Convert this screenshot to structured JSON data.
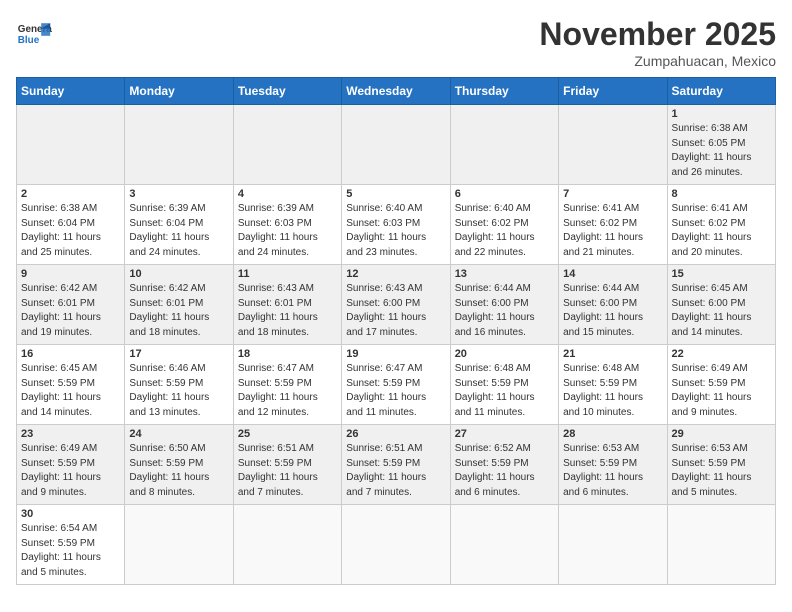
{
  "header": {
    "logo_general": "General",
    "logo_blue": "Blue",
    "month": "November 2025",
    "location": "Zumpahuacan, Mexico"
  },
  "weekdays": [
    "Sunday",
    "Monday",
    "Tuesday",
    "Wednesday",
    "Thursday",
    "Friday",
    "Saturday"
  ],
  "weeks": [
    [
      {
        "day": "",
        "info": ""
      },
      {
        "day": "",
        "info": ""
      },
      {
        "day": "",
        "info": ""
      },
      {
        "day": "",
        "info": ""
      },
      {
        "day": "",
        "info": ""
      },
      {
        "day": "",
        "info": ""
      },
      {
        "day": "1",
        "info": "Sunrise: 6:38 AM\nSunset: 6:05 PM\nDaylight: 11 hours\nand 26 minutes."
      }
    ],
    [
      {
        "day": "2",
        "info": "Sunrise: 6:38 AM\nSunset: 6:04 PM\nDaylight: 11 hours\nand 25 minutes."
      },
      {
        "day": "3",
        "info": "Sunrise: 6:39 AM\nSunset: 6:04 PM\nDaylight: 11 hours\nand 24 minutes."
      },
      {
        "day": "4",
        "info": "Sunrise: 6:39 AM\nSunset: 6:03 PM\nDaylight: 11 hours\nand 24 minutes."
      },
      {
        "day": "5",
        "info": "Sunrise: 6:40 AM\nSunset: 6:03 PM\nDaylight: 11 hours\nand 23 minutes."
      },
      {
        "day": "6",
        "info": "Sunrise: 6:40 AM\nSunset: 6:02 PM\nDaylight: 11 hours\nand 22 minutes."
      },
      {
        "day": "7",
        "info": "Sunrise: 6:41 AM\nSunset: 6:02 PM\nDaylight: 11 hours\nand 21 minutes."
      },
      {
        "day": "8",
        "info": "Sunrise: 6:41 AM\nSunset: 6:02 PM\nDaylight: 11 hours\nand 20 minutes."
      }
    ],
    [
      {
        "day": "9",
        "info": "Sunrise: 6:42 AM\nSunset: 6:01 PM\nDaylight: 11 hours\nand 19 minutes."
      },
      {
        "day": "10",
        "info": "Sunrise: 6:42 AM\nSunset: 6:01 PM\nDaylight: 11 hours\nand 18 minutes."
      },
      {
        "day": "11",
        "info": "Sunrise: 6:43 AM\nSunset: 6:01 PM\nDaylight: 11 hours\nand 18 minutes."
      },
      {
        "day": "12",
        "info": "Sunrise: 6:43 AM\nSunset: 6:00 PM\nDaylight: 11 hours\nand 17 minutes."
      },
      {
        "day": "13",
        "info": "Sunrise: 6:44 AM\nSunset: 6:00 PM\nDaylight: 11 hours\nand 16 minutes."
      },
      {
        "day": "14",
        "info": "Sunrise: 6:44 AM\nSunset: 6:00 PM\nDaylight: 11 hours\nand 15 minutes."
      },
      {
        "day": "15",
        "info": "Sunrise: 6:45 AM\nSunset: 6:00 PM\nDaylight: 11 hours\nand 14 minutes."
      }
    ],
    [
      {
        "day": "16",
        "info": "Sunrise: 6:45 AM\nSunset: 5:59 PM\nDaylight: 11 hours\nand 14 minutes."
      },
      {
        "day": "17",
        "info": "Sunrise: 6:46 AM\nSunset: 5:59 PM\nDaylight: 11 hours\nand 13 minutes."
      },
      {
        "day": "18",
        "info": "Sunrise: 6:47 AM\nSunset: 5:59 PM\nDaylight: 11 hours\nand 12 minutes."
      },
      {
        "day": "19",
        "info": "Sunrise: 6:47 AM\nSunset: 5:59 PM\nDaylight: 11 hours\nand 11 minutes."
      },
      {
        "day": "20",
        "info": "Sunrise: 6:48 AM\nSunset: 5:59 PM\nDaylight: 11 hours\nand 11 minutes."
      },
      {
        "day": "21",
        "info": "Sunrise: 6:48 AM\nSunset: 5:59 PM\nDaylight: 11 hours\nand 10 minutes."
      },
      {
        "day": "22",
        "info": "Sunrise: 6:49 AM\nSunset: 5:59 PM\nDaylight: 11 hours\nand 9 minutes."
      }
    ],
    [
      {
        "day": "23",
        "info": "Sunrise: 6:49 AM\nSunset: 5:59 PM\nDaylight: 11 hours\nand 9 minutes."
      },
      {
        "day": "24",
        "info": "Sunrise: 6:50 AM\nSunset: 5:59 PM\nDaylight: 11 hours\nand 8 minutes."
      },
      {
        "day": "25",
        "info": "Sunrise: 6:51 AM\nSunset: 5:59 PM\nDaylight: 11 hours\nand 7 minutes."
      },
      {
        "day": "26",
        "info": "Sunrise: 6:51 AM\nSunset: 5:59 PM\nDaylight: 11 hours\nand 7 minutes."
      },
      {
        "day": "27",
        "info": "Sunrise: 6:52 AM\nSunset: 5:59 PM\nDaylight: 11 hours\nand 6 minutes."
      },
      {
        "day": "28",
        "info": "Sunrise: 6:53 AM\nSunset: 5:59 PM\nDaylight: 11 hours\nand 6 minutes."
      },
      {
        "day": "29",
        "info": "Sunrise: 6:53 AM\nSunset: 5:59 PM\nDaylight: 11 hours\nand 5 minutes."
      }
    ],
    [
      {
        "day": "30",
        "info": "Sunrise: 6:54 AM\nSunset: 5:59 PM\nDaylight: 11 hours\nand 5 minutes."
      },
      {
        "day": "",
        "info": ""
      },
      {
        "day": "",
        "info": ""
      },
      {
        "day": "",
        "info": ""
      },
      {
        "day": "",
        "info": ""
      },
      {
        "day": "",
        "info": ""
      },
      {
        "day": "",
        "info": ""
      }
    ]
  ]
}
